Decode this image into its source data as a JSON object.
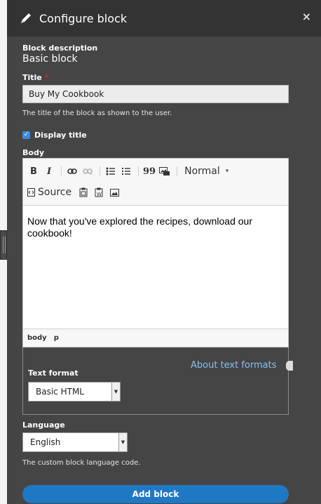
{
  "dialog": {
    "title": "Configure block",
    "close_label": "×"
  },
  "block_description": {
    "label": "Block description",
    "value": "Basic block"
  },
  "title_field": {
    "label": "Title",
    "required_mark": "*",
    "value": "Buy My Cookbook",
    "description": "The title of the block as shown to the user."
  },
  "display_title": {
    "label": "Display title",
    "checked": true
  },
  "body": {
    "label": "Body",
    "toolbar": {
      "bold": "B",
      "italic": "I",
      "link_icon": "link-icon",
      "unlink_icon": "unlink-icon",
      "bullet_list_icon": "bulleted-list-icon",
      "numbered_list_icon": "numbered-list-icon",
      "blockquote": "99",
      "image_icon": "image-icon",
      "format_select": "Normal",
      "source": "Source",
      "paste_text_icon": "paste-text-icon",
      "paste_word_icon": "paste-from-word-icon",
      "insert_image_icon": "insert-image-icon"
    },
    "content": "Now that you've explored the recipes, download our cookbook!",
    "path": [
      "body",
      "p"
    ]
  },
  "text_format": {
    "label": "Text format",
    "selected": "Basic HTML",
    "about_link": "About text formats"
  },
  "language": {
    "label": "Language",
    "selected": "English",
    "description": "The custom block language code."
  },
  "submit": {
    "label": "Add block"
  },
  "colors": {
    "panel": "#454545",
    "titlebar": "#333333",
    "accent": "#1f78c4",
    "link": "#86c0f0",
    "required": "#e32700"
  }
}
